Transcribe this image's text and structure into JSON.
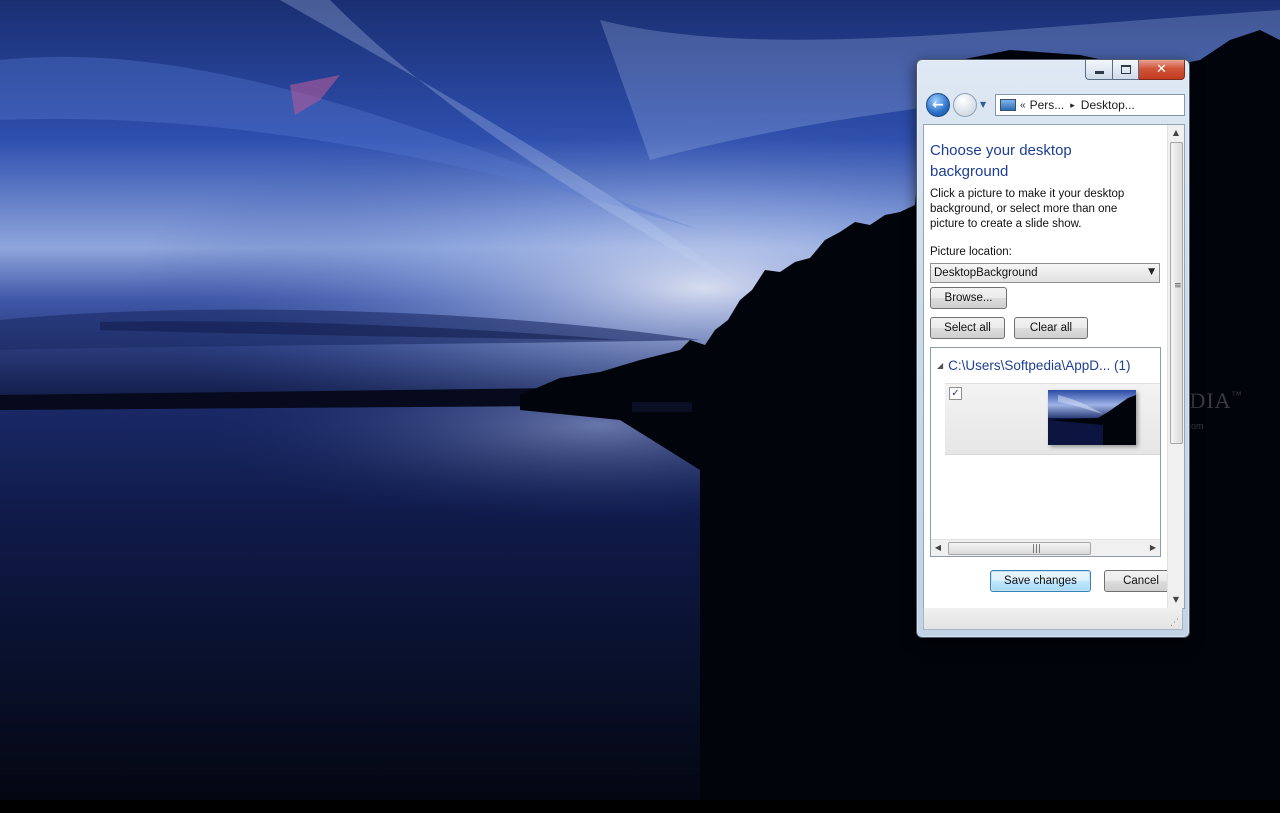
{
  "window": {
    "close_glyph": "✕",
    "nav": {
      "back_glyph": "←",
      "address_sep": "«",
      "breadcrumb_1": "Pers...",
      "breadcrumb_arrow": "▸",
      "breadcrumb_2": "Desktop..."
    },
    "heading": "Choose your desktop background",
    "description": "Click a picture to make it your desktop background, or select more than one picture to create a slide show.",
    "picture_location_label": "Picture location:",
    "picture_location_value": "DesktopBackground",
    "browse_label": "Browse...",
    "select_all_label": "Select all",
    "clear_all_label": "Clear all",
    "gallery": {
      "group_label": "C:\\Users\\Softpedia\\AppD...",
      "group_count": "(1)",
      "items": [
        {
          "checked": true,
          "check_glyph": "✓"
        }
      ]
    },
    "save_label": "Save changes",
    "cancel_label": "Cancel"
  },
  "watermark": {
    "text": "SOFTPEDIA",
    "tm": "™",
    "url": "www.softpedia.com"
  },
  "colors": {
    "heading": "#1e3e91",
    "close_button": "#c23b1f",
    "accent_button": "#3c7fb1"
  }
}
